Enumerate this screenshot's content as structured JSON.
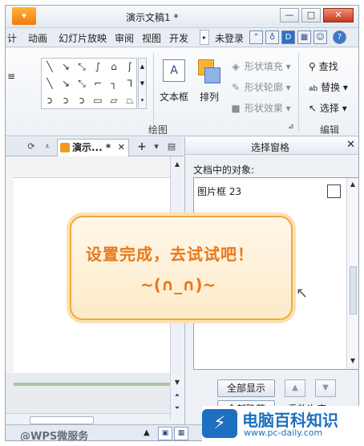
{
  "window": {
    "app_button": "▾",
    "title": "演示文稿1 *",
    "minimize": "—",
    "maximize": "□",
    "close": "✕"
  },
  "menubar": {
    "items": [
      "计",
      "动画",
      "幻灯片放映",
      "审阅",
      "视图",
      "开发"
    ],
    "more": "▸",
    "login": "未登录"
  },
  "ribbon": {
    "left_fragment": "≡",
    "textbox_label": "文本框",
    "textbox_icon": "A",
    "arrange_label": "排列",
    "shape_fill": "形状填充",
    "shape_outline": "形状轮廓",
    "shape_effect": "形状效果",
    "find": "查找",
    "replace": "替换",
    "select": "选择",
    "group_drawing": "绘图",
    "group_edit": "编辑"
  },
  "doctab": {
    "label": "演示... *",
    "close": "✕",
    "add": "+"
  },
  "pane": {
    "title": "选择窗格",
    "close": "✕",
    "objects_label": "文档中的对象:",
    "objects": [
      {
        "name": "图片框 23",
        "visible": false
      }
    ],
    "show_all": "全部显示",
    "hide_all": "全部隐藏",
    "reorder": "重放次序"
  },
  "callout": {
    "line1": "设置完成，去试试吧！",
    "line2": "~(∩_∩)~"
  },
  "statusbar": {
    "watermark_text": "@WPS微服务"
  },
  "overlay": {
    "site_name": "电脑百科知识",
    "site_url": "www.pc-daily.com",
    "logo_icon": "monitor-icon"
  },
  "colors": {
    "callout_text": "#e8781b",
    "callout_border": "#f0a93e",
    "brand_blue": "#1d6fbf"
  }
}
